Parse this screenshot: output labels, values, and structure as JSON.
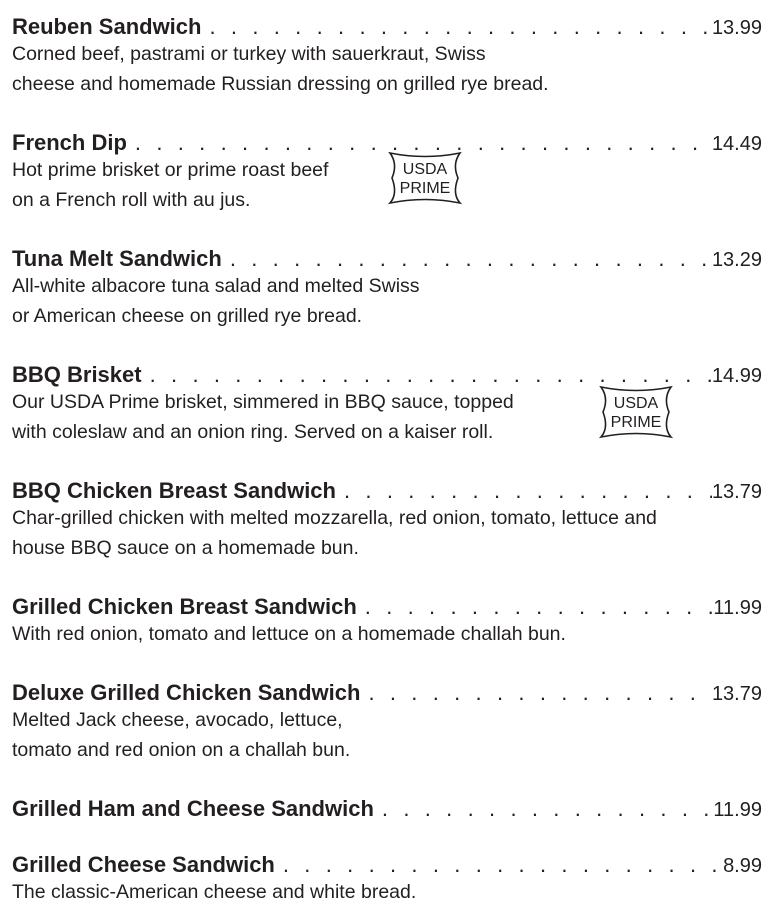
{
  "items": [
    {
      "name": "Reuben Sandwich",
      "price": "13.99",
      "desc": [
        "Corned beef, pastrami or turkey with sauerkraut, Swiss",
        "cheese and homemade Russian dressing on grilled rye bread."
      ]
    },
    {
      "name": "French Dip",
      "price": "14.49",
      "desc": [
        "Hot prime brisket or prime roast beef",
        "on a French roll with au jus."
      ],
      "badge": {
        "line1": "USDA",
        "line2": "PRIME"
      }
    },
    {
      "name": "Tuna Melt Sandwich",
      "price": "13.29",
      "desc": [
        "All-white albacore tuna salad and melted Swiss",
        "or American cheese on grilled rye bread."
      ]
    },
    {
      "name": "BBQ Brisket",
      "price": "14.99",
      "desc": [
        "Our USDA Prime brisket, simmered in BBQ sauce, topped",
        "with coleslaw and an onion ring. Served on a kaiser roll."
      ],
      "badge": {
        "line1": "USDA",
        "line2": "PRIME"
      }
    },
    {
      "name": "BBQ Chicken Breast Sandwich",
      "price": "13.79",
      "desc": [
        "Char-grilled chicken with melted mozzarella, red onion, tomato, lettuce and",
        "house BBQ sauce on a homemade bun."
      ]
    },
    {
      "name": "Grilled Chicken Breast Sandwich",
      "price": "11.99",
      "desc": [
        "With red onion, tomato and lettuce on a homemade challah bun."
      ]
    },
    {
      "name": "Deluxe Grilled Chicken Sandwich",
      "price": "13.79",
      "desc": [
        "Melted Jack cheese, avocado, lettuce,",
        "tomato and red onion on a challah bun."
      ]
    },
    {
      "name": "Grilled Ham and Cheese Sandwich",
      "price": "11.99",
      "desc": []
    },
    {
      "name": "Grilled Cheese Sandwich",
      "price": "8.99",
      "desc": [
        "The classic-American cheese and white bread."
      ]
    }
  ]
}
